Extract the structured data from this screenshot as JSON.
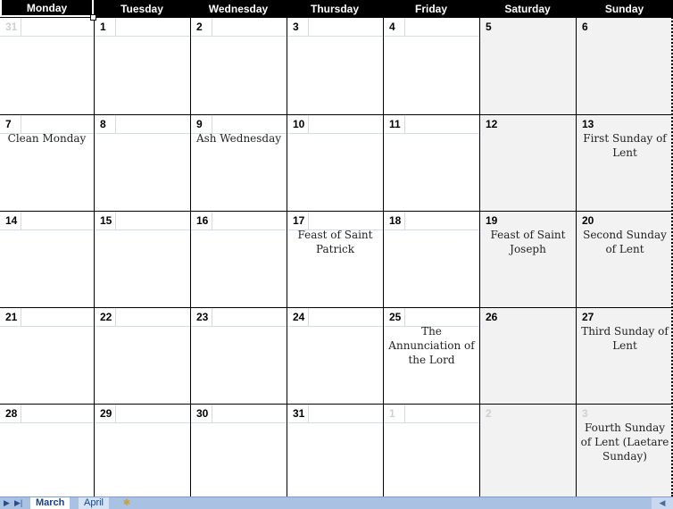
{
  "weekdays": [
    "Monday",
    "Tuesday",
    "Wednesday",
    "Thursday",
    "Friday",
    "Saturday",
    "Sunday"
  ],
  "weeks": [
    [
      {
        "day": "31",
        "current": false,
        "event": ""
      },
      {
        "day": "1",
        "current": true,
        "event": ""
      },
      {
        "day": "2",
        "current": true,
        "event": ""
      },
      {
        "day": "3",
        "current": true,
        "event": ""
      },
      {
        "day": "4",
        "current": true,
        "event": ""
      },
      {
        "day": "5",
        "current": true,
        "event": ""
      },
      {
        "day": "6",
        "current": true,
        "event": ""
      }
    ],
    [
      {
        "day": "7",
        "current": true,
        "event": "Clean Monday"
      },
      {
        "day": "8",
        "current": true,
        "event": ""
      },
      {
        "day": "9",
        "current": true,
        "event": "Ash Wednesday"
      },
      {
        "day": "10",
        "current": true,
        "event": ""
      },
      {
        "day": "11",
        "current": true,
        "event": ""
      },
      {
        "day": "12",
        "current": true,
        "event": ""
      },
      {
        "day": "13",
        "current": true,
        "event": "First Sunday of Lent"
      }
    ],
    [
      {
        "day": "14",
        "current": true,
        "event": ""
      },
      {
        "day": "15",
        "current": true,
        "event": ""
      },
      {
        "day": "16",
        "current": true,
        "event": ""
      },
      {
        "day": "17",
        "current": true,
        "event": "Feast of Saint Patrick"
      },
      {
        "day": "18",
        "current": true,
        "event": ""
      },
      {
        "day": "19",
        "current": true,
        "event": "Feast of Saint Joseph"
      },
      {
        "day": "20",
        "current": true,
        "event": "Second Sunday of Lent"
      }
    ],
    [
      {
        "day": "21",
        "current": true,
        "event": ""
      },
      {
        "day": "22",
        "current": true,
        "event": ""
      },
      {
        "day": "23",
        "current": true,
        "event": ""
      },
      {
        "day": "24",
        "current": true,
        "event": ""
      },
      {
        "day": "25",
        "current": true,
        "event": "The Annunciation of the Lord"
      },
      {
        "day": "26",
        "current": true,
        "event": ""
      },
      {
        "day": "27",
        "current": true,
        "event": "Third Sunday of Lent"
      }
    ],
    [
      {
        "day": "28",
        "current": true,
        "event": ""
      },
      {
        "day": "29",
        "current": true,
        "event": ""
      },
      {
        "day": "30",
        "current": true,
        "event": ""
      },
      {
        "day": "31",
        "current": true,
        "event": ""
      },
      {
        "day": "1",
        "current": false,
        "event": ""
      },
      {
        "day": "2",
        "current": false,
        "event": ""
      },
      {
        "day": "3",
        "current": false,
        "event": "Fourth Sunday of Lent (Laetare Sunday)"
      }
    ]
  ],
  "sheet_tabs": {
    "nav_next": "▶",
    "nav_last": "▶|",
    "tabs": [
      {
        "label": "March",
        "active": true
      },
      {
        "label": "April",
        "active": false
      }
    ],
    "new_sheet_icon": "✱",
    "scroll_left": "◀"
  },
  "colors": {
    "header_bg": "#000000",
    "weekend_bg": "#f2f2f2",
    "other_month_text": "#d0d0d0",
    "tabbar_bg": "#a9c1e2"
  }
}
